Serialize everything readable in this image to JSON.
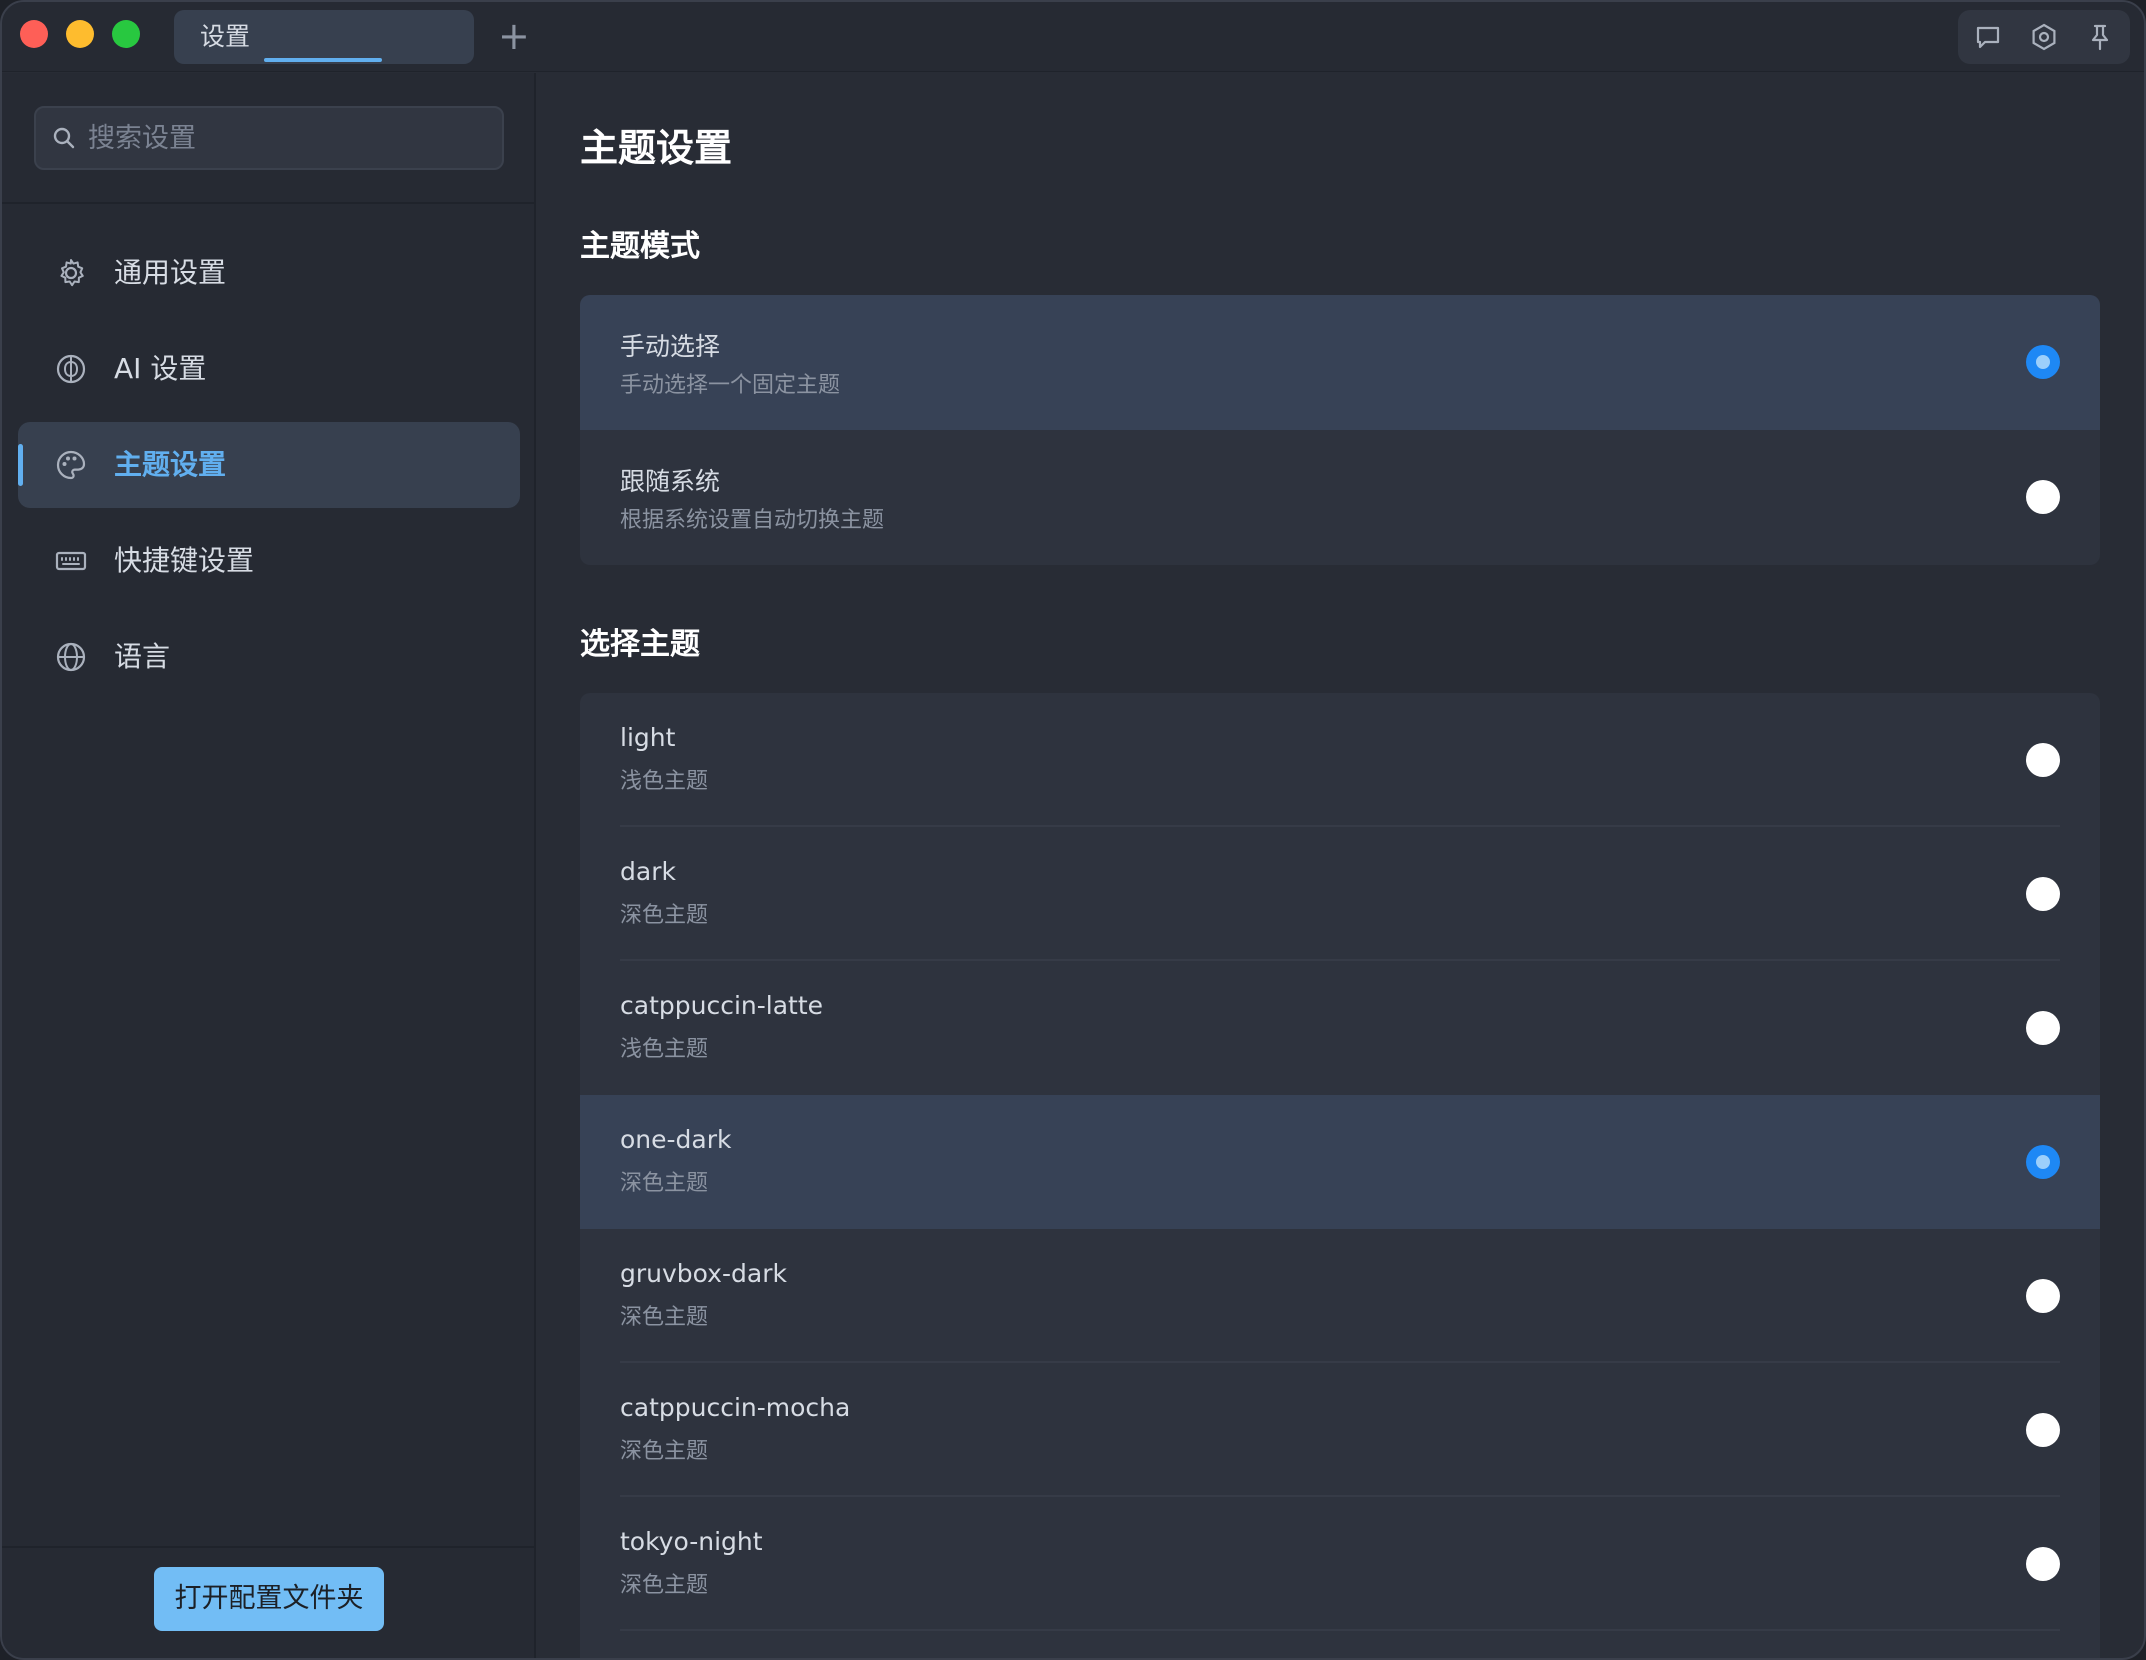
{
  "tab": {
    "label": "设置"
  },
  "search": {
    "placeholder": "搜索设置"
  },
  "sidebar": {
    "items": [
      {
        "label": "通用设置",
        "icon": "gear-icon"
      },
      {
        "label": "AI 设置",
        "icon": "ai-brain-icon"
      },
      {
        "label": "主题设置",
        "icon": "palette-icon"
      },
      {
        "label": "快捷键设置",
        "icon": "keyboard-icon"
      },
      {
        "label": "语言",
        "icon": "globe-icon"
      }
    ],
    "active_index": 2,
    "open_config_label": "打开配置文件夹"
  },
  "main": {
    "title": "主题设置",
    "mode_section": {
      "title": "主题模式",
      "options": [
        {
          "title": "手动选择",
          "subtitle": "手动选择一个固定主题",
          "selected": true
        },
        {
          "title": "跟随系统",
          "subtitle": "根据系统设置自动切换主题",
          "selected": false
        }
      ]
    },
    "theme_section": {
      "title": "选择主题",
      "themes": [
        {
          "name": "light",
          "desc": "浅色主题",
          "selected": false
        },
        {
          "name": "dark",
          "desc": "深色主题",
          "selected": false
        },
        {
          "name": "catppuccin-latte",
          "desc": "浅色主题",
          "selected": false
        },
        {
          "name": "one-dark",
          "desc": "深色主题",
          "selected": true
        },
        {
          "name": "gruvbox-dark",
          "desc": "深色主题",
          "selected": false
        },
        {
          "name": "catppuccin-mocha",
          "desc": "深色主题",
          "selected": false
        },
        {
          "name": "tokyo-night",
          "desc": "深色主题",
          "selected": false
        }
      ]
    }
  },
  "colors": {
    "accent": "#61afef",
    "radio_on": "#1e88f5",
    "button": "#72bdf5",
    "traffic_close": "#fe5f57",
    "traffic_minimize": "#febc2e",
    "traffic_maximize": "#28c840"
  }
}
